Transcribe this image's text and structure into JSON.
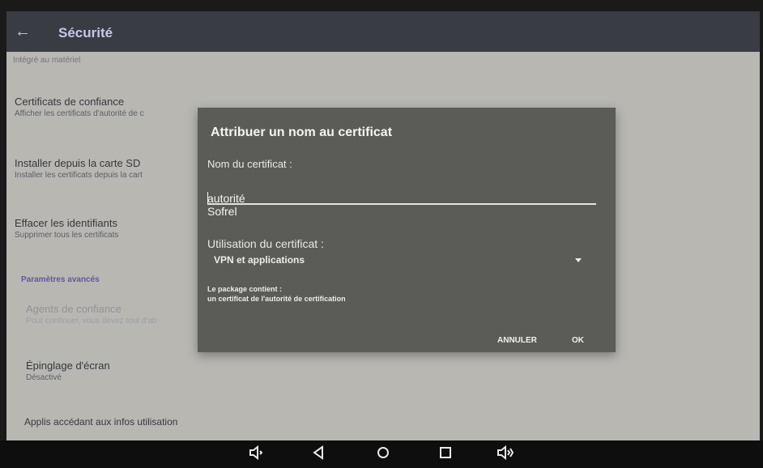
{
  "appbar": {
    "back_icon": "arrow-left-icon",
    "title": "Sécurité"
  },
  "settings": {
    "partial_item": "Intégré au matériel",
    "items": [
      {
        "title": "Certificats de confiance",
        "subtitle": "Afficher les certificats d'autorité de c"
      },
      {
        "title": "Installer depuis la carte SD",
        "subtitle": "Installer les certificats depuis la cart"
      },
      {
        "title": "Effacer les identifiants",
        "subtitle": "Supprimer tous les certificats"
      }
    ],
    "category": "Paramètres avancés",
    "disabled_item": {
      "title": "Agents de confiance",
      "subtitle": "Pour continuer, vous devez tout d'ab"
    },
    "pinning": {
      "title": "Épinglage d'écran",
      "subtitle": "Désactivé"
    },
    "last_item": "Applis accédant aux infos utilisation"
  },
  "dialog": {
    "title": "Attribuer un nom au certificat",
    "name_label": "Nom du certificat :",
    "name_value": "autorité Sofrel",
    "usage_label": "Utilisation du certificat :",
    "usage_value": "VPN et applications",
    "package_label": "Le package contient :",
    "package_content": "un certificat de l'autorité de certification",
    "cancel_label": "ANNULER",
    "ok_label": "OK"
  },
  "navbar": {
    "icons": [
      "volume-down-icon",
      "back-triangle-icon",
      "home-circle-icon",
      "recents-square-icon",
      "volume-up-icon"
    ]
  },
  "colors": {
    "appbar": "#3a3c44",
    "dialog": "#5b5b58",
    "category": "#5c4b9a"
  }
}
